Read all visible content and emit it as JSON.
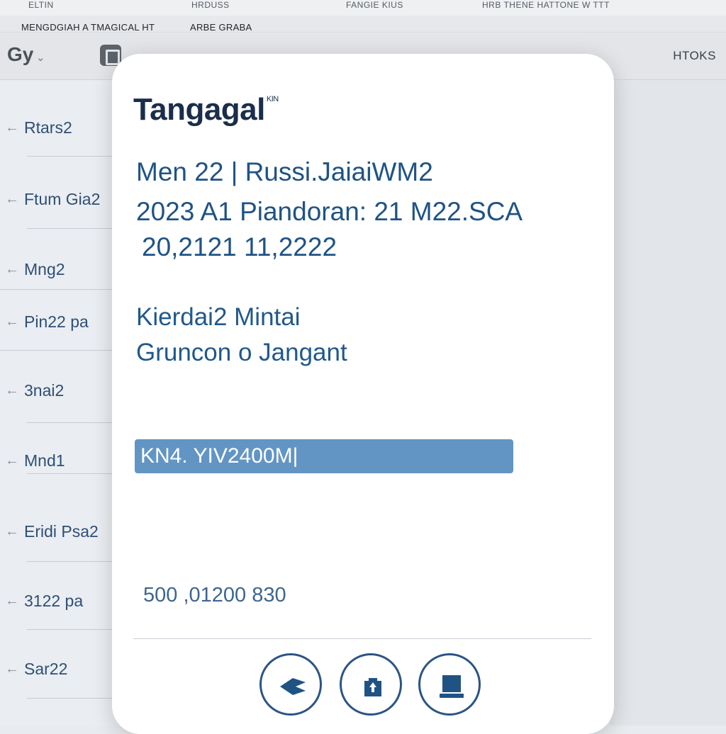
{
  "top_strip": {
    "fragments": [
      "ELTIN",
      "HRDUSS",
      "FANGIE KIUS",
      "HRB THENE HATTONE W TTT"
    ]
  },
  "menu": {
    "items": [
      "MENGDGIAH A TMAGICAL HT",
      "ARBE GRABA"
    ]
  },
  "toolbar": {
    "brand": "Gy",
    "tools_link": "HTOKS"
  },
  "sidebar": {
    "items": [
      {
        "label": "Rtars2"
      },
      {
        "label": "Ftum Gia2"
      },
      {
        "label": "Mng2"
      },
      {
        "label": "Pin22 pa"
      },
      {
        "label": "3nai2"
      },
      {
        "label": "Mnd1"
      },
      {
        "label": "Eridi Psa2"
      },
      {
        "label": "3122 pa"
      },
      {
        "label": "Sar22"
      }
    ]
  },
  "modal": {
    "title": "Tangagal",
    "title_sup": "KIN",
    "info_line_1": "Men 22 | Russi.JaiaiWM2",
    "info_line_2": "2023 A1 Piandoran: 21 M22.SCA",
    "info_line_3": "20,2121 11,2222",
    "sub_line_1": "Kierdai2 Mintai",
    "sub_line_2": "Gruncon o Jangant",
    "input_value": "KN4. YIV2400M|",
    "footer_number": "500 ,01200 830",
    "buttons": [
      {
        "icon": "back-arrow-icon"
      },
      {
        "icon": "share-upload-icon"
      },
      {
        "icon": "monitor-icon"
      }
    ]
  },
  "colors": {
    "title": "#1a2e4b",
    "text_blue": "#1f5384",
    "input_fill": "#6295c4",
    "button_border": "#2b5584"
  }
}
